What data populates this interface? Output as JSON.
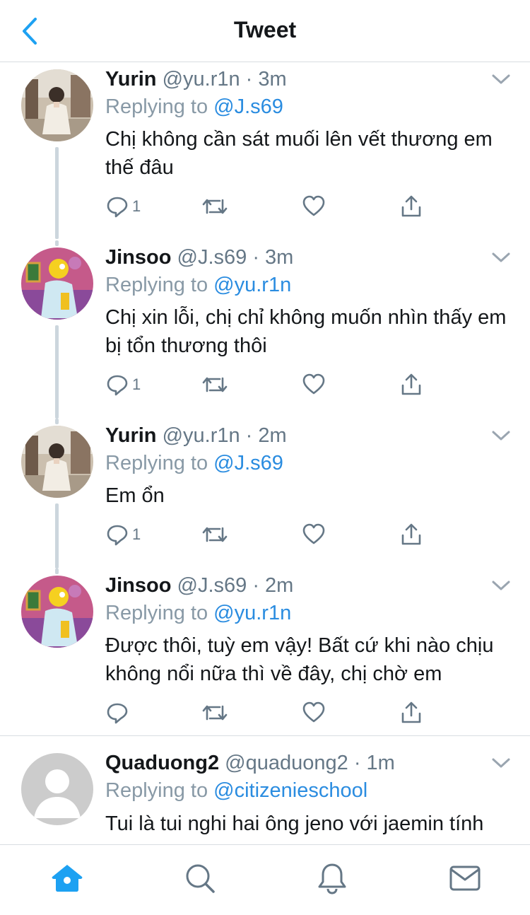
{
  "header": {
    "title": "Tweet",
    "back_icon": "chevron-left-icon"
  },
  "colors": {
    "accent": "#1da1f2",
    "link": "#2a8ce0",
    "muted": "#657786",
    "thread": "#ccd6dd"
  },
  "tweets": [
    {
      "name": "Yurin",
      "handle": "@yu.r1n · 3m",
      "replying_prefix": "Replying to",
      "replying_to": "@J.s69",
      "text": "Chị không cần sát muối lên vết thương em thế đâu",
      "reply_count": "1",
      "avatar": "photo-avatar"
    },
    {
      "name": "Jinsoo",
      "handle": "@J.s69 · 3m",
      "replying_prefix": "Replying to",
      "replying_to": "@yu.r1n",
      "text": "Chị xin lỗi, chị chỉ không muốn nhìn thấy em bị tổn thương thôi",
      "reply_count": "1",
      "avatar": "cartoon-avatar"
    },
    {
      "name": "Yurin",
      "handle": "@yu.r1n · 2m",
      "replying_prefix": "Replying to",
      "replying_to": "@J.s69",
      "text": "Em ổn",
      "reply_count": "1",
      "avatar": "photo-avatar"
    },
    {
      "name": "Jinsoo",
      "handle": "@J.s69 · 2m",
      "replying_prefix": "Replying to",
      "replying_to": "@yu.r1n",
      "text": "Được thôi, tuỳ em vậy! Bất cứ khi nào chịu không nổi nữa thì về đây, chị chờ em",
      "reply_count": "",
      "avatar": "cartoon-avatar"
    },
    {
      "name": "Quaduong2",
      "handle": "@quaduong2 · 1m",
      "replying_prefix": "Replying to",
      "replying_to": "@citizenieschool",
      "text": "Tui là tui nghi hai ông jeno với jaemin tính",
      "reply_count": "",
      "avatar": "default-avatar"
    }
  ],
  "tabbar": {
    "items": [
      "home-icon",
      "search-icon",
      "notifications-icon",
      "messages-icon"
    ],
    "active": "home-icon"
  }
}
